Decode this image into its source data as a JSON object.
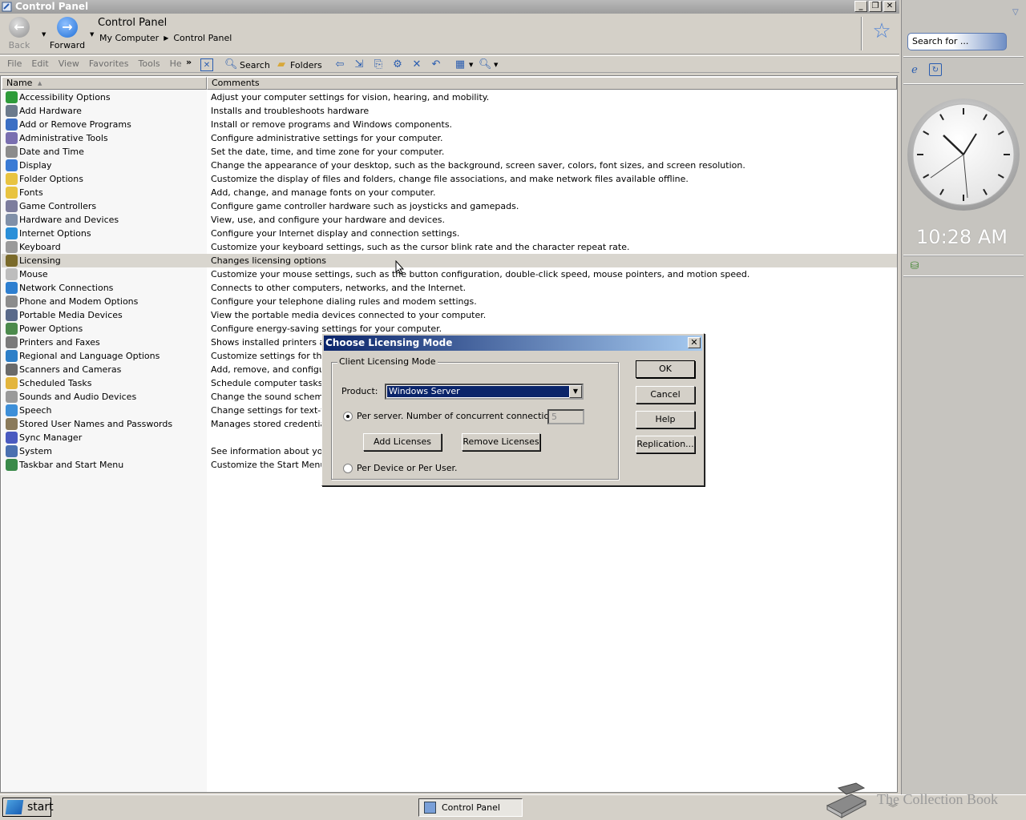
{
  "window": {
    "title": "Control Panel",
    "buttons": {
      "minimize": "_",
      "restore": "❐",
      "close": "✕"
    }
  },
  "nav": {
    "back_label": "Back",
    "forward_label": "Forward",
    "address_title": "Control Panel",
    "breadcrumbs": [
      "My Computer",
      "Control Panel"
    ]
  },
  "menu": {
    "items": [
      "File",
      "Edit",
      "View",
      "Favorites",
      "Tools",
      "He"
    ],
    "chevron": "»"
  },
  "toolbar": {
    "search_label": "Search",
    "folders_label": "Folders"
  },
  "columns": {
    "name": "Name",
    "comments": "Comments"
  },
  "items": [
    {
      "name": "Accessibility Options",
      "comment": "Adjust your computer settings for vision, hearing, and mobility.",
      "icon_color": "#2e9b3a"
    },
    {
      "name": "Add Hardware",
      "comment": "Installs and troubleshoots hardware",
      "icon_color": "#6b7a8c"
    },
    {
      "name": "Add or Remove Programs",
      "comment": "Install or remove programs and Windows components.",
      "icon_color": "#3b6fc4"
    },
    {
      "name": "Administrative Tools",
      "comment": "Configure administrative settings for your computer.",
      "icon_color": "#7a6fb0"
    },
    {
      "name": "Date and Time",
      "comment": "Set the date, time, and time zone for your computer.",
      "icon_color": "#8c8c8c"
    },
    {
      "name": "Display",
      "comment": "Change the appearance of your desktop, such as the background, screen saver, colors, font sizes, and screen resolution.",
      "icon_color": "#3a7bd5"
    },
    {
      "name": "Folder Options",
      "comment": "Customize the display of files and folders, change file associations, and make network files available offline.",
      "icon_color": "#e8c340"
    },
    {
      "name": "Fonts",
      "comment": "Add, change, and manage fonts on your computer.",
      "icon_color": "#e8c340"
    },
    {
      "name": "Game Controllers",
      "comment": "Configure game controller hardware such as joysticks and gamepads.",
      "icon_color": "#7d7d9d"
    },
    {
      "name": "Hardware and Devices",
      "comment": "View, use, and configure your hardware and devices.",
      "icon_color": "#8090a8"
    },
    {
      "name": "Internet Options",
      "comment": "Configure your Internet display and connection settings.",
      "icon_color": "#2a8fd8"
    },
    {
      "name": "Keyboard",
      "comment": "Customize your keyboard settings, such as the cursor blink rate and the character repeat rate.",
      "icon_color": "#9a9a9a"
    },
    {
      "name": "Licensing",
      "comment": "Changes licensing options",
      "icon_color": "#7a6a2a"
    },
    {
      "name": "Mouse",
      "comment": "Customize your mouse settings, such as the button configuration, double-click speed, mouse pointers, and motion speed.",
      "icon_color": "#bdbdbd"
    },
    {
      "name": "Network Connections",
      "comment": "Connects to other computers, networks, and the Internet.",
      "icon_color": "#2e7fd0"
    },
    {
      "name": "Phone and Modem Options",
      "comment": "Configure your telephone dialing rules and modem settings.",
      "icon_color": "#8c8c8c"
    },
    {
      "name": "Portable Media Devices",
      "comment": "View the portable media devices connected to your computer.",
      "icon_color": "#5a6a8a"
    },
    {
      "name": "Power Options",
      "comment": "Configure energy-saving settings for your computer.",
      "icon_color": "#4c8a4c"
    },
    {
      "name": "Printers and Faxes",
      "comment": "Shows installed printers and f",
      "icon_color": "#7a7a7a"
    },
    {
      "name": "Regional and Language Options",
      "comment": "Customize settings for the dis",
      "icon_color": "#2d7fc8"
    },
    {
      "name": "Scanners and Cameras",
      "comment": "Add, remove, and configure",
      "icon_color": "#6a6a6a"
    },
    {
      "name": "Scheduled Tasks",
      "comment": "Schedule computer tasks to r",
      "icon_color": "#e3b53c"
    },
    {
      "name": "Sounds and Audio Devices",
      "comment": "Change the sound scheme fo",
      "icon_color": "#9a9a9a"
    },
    {
      "name": "Speech",
      "comment": "Change settings for text-to-s",
      "icon_color": "#3d8fd8"
    },
    {
      "name": "Stored User Names and Passwords",
      "comment": "Manages stored credentials fo",
      "icon_color": "#8a7a5a"
    },
    {
      "name": "Sync Manager",
      "comment": "",
      "icon_color": "#4a5ac0"
    },
    {
      "name": "System",
      "comment": "See information about your c",
      "icon_color": "#4a70b0"
    },
    {
      "name": "Taskbar and Start Menu",
      "comment": "Customize the Start Menu an",
      "icon_color": "#3a8a4a"
    }
  ],
  "selected_item": "Licensing",
  "dialog": {
    "title": "Choose Licensing Mode",
    "close": "✕",
    "group_label": "Client Licensing Mode",
    "product_label": "Product:",
    "product_value": "Windows Server",
    "per_server_label": "Per server. Number of concurrent connections:",
    "connections_value": "5",
    "add_licenses": "Add Licenses",
    "remove_licenses": "Remove Licenses",
    "per_device_label": "Per Device or Per User.",
    "ok": "OK",
    "cancel": "Cancel",
    "help": "Help",
    "replication": "Replication..."
  },
  "sidebar": {
    "search_placeholder": "Search for ...",
    "clock_time": "10:28 AM"
  },
  "taskbar": {
    "start_label": "start",
    "task_label": "Control Panel",
    "watermark": "The Collection Book"
  }
}
